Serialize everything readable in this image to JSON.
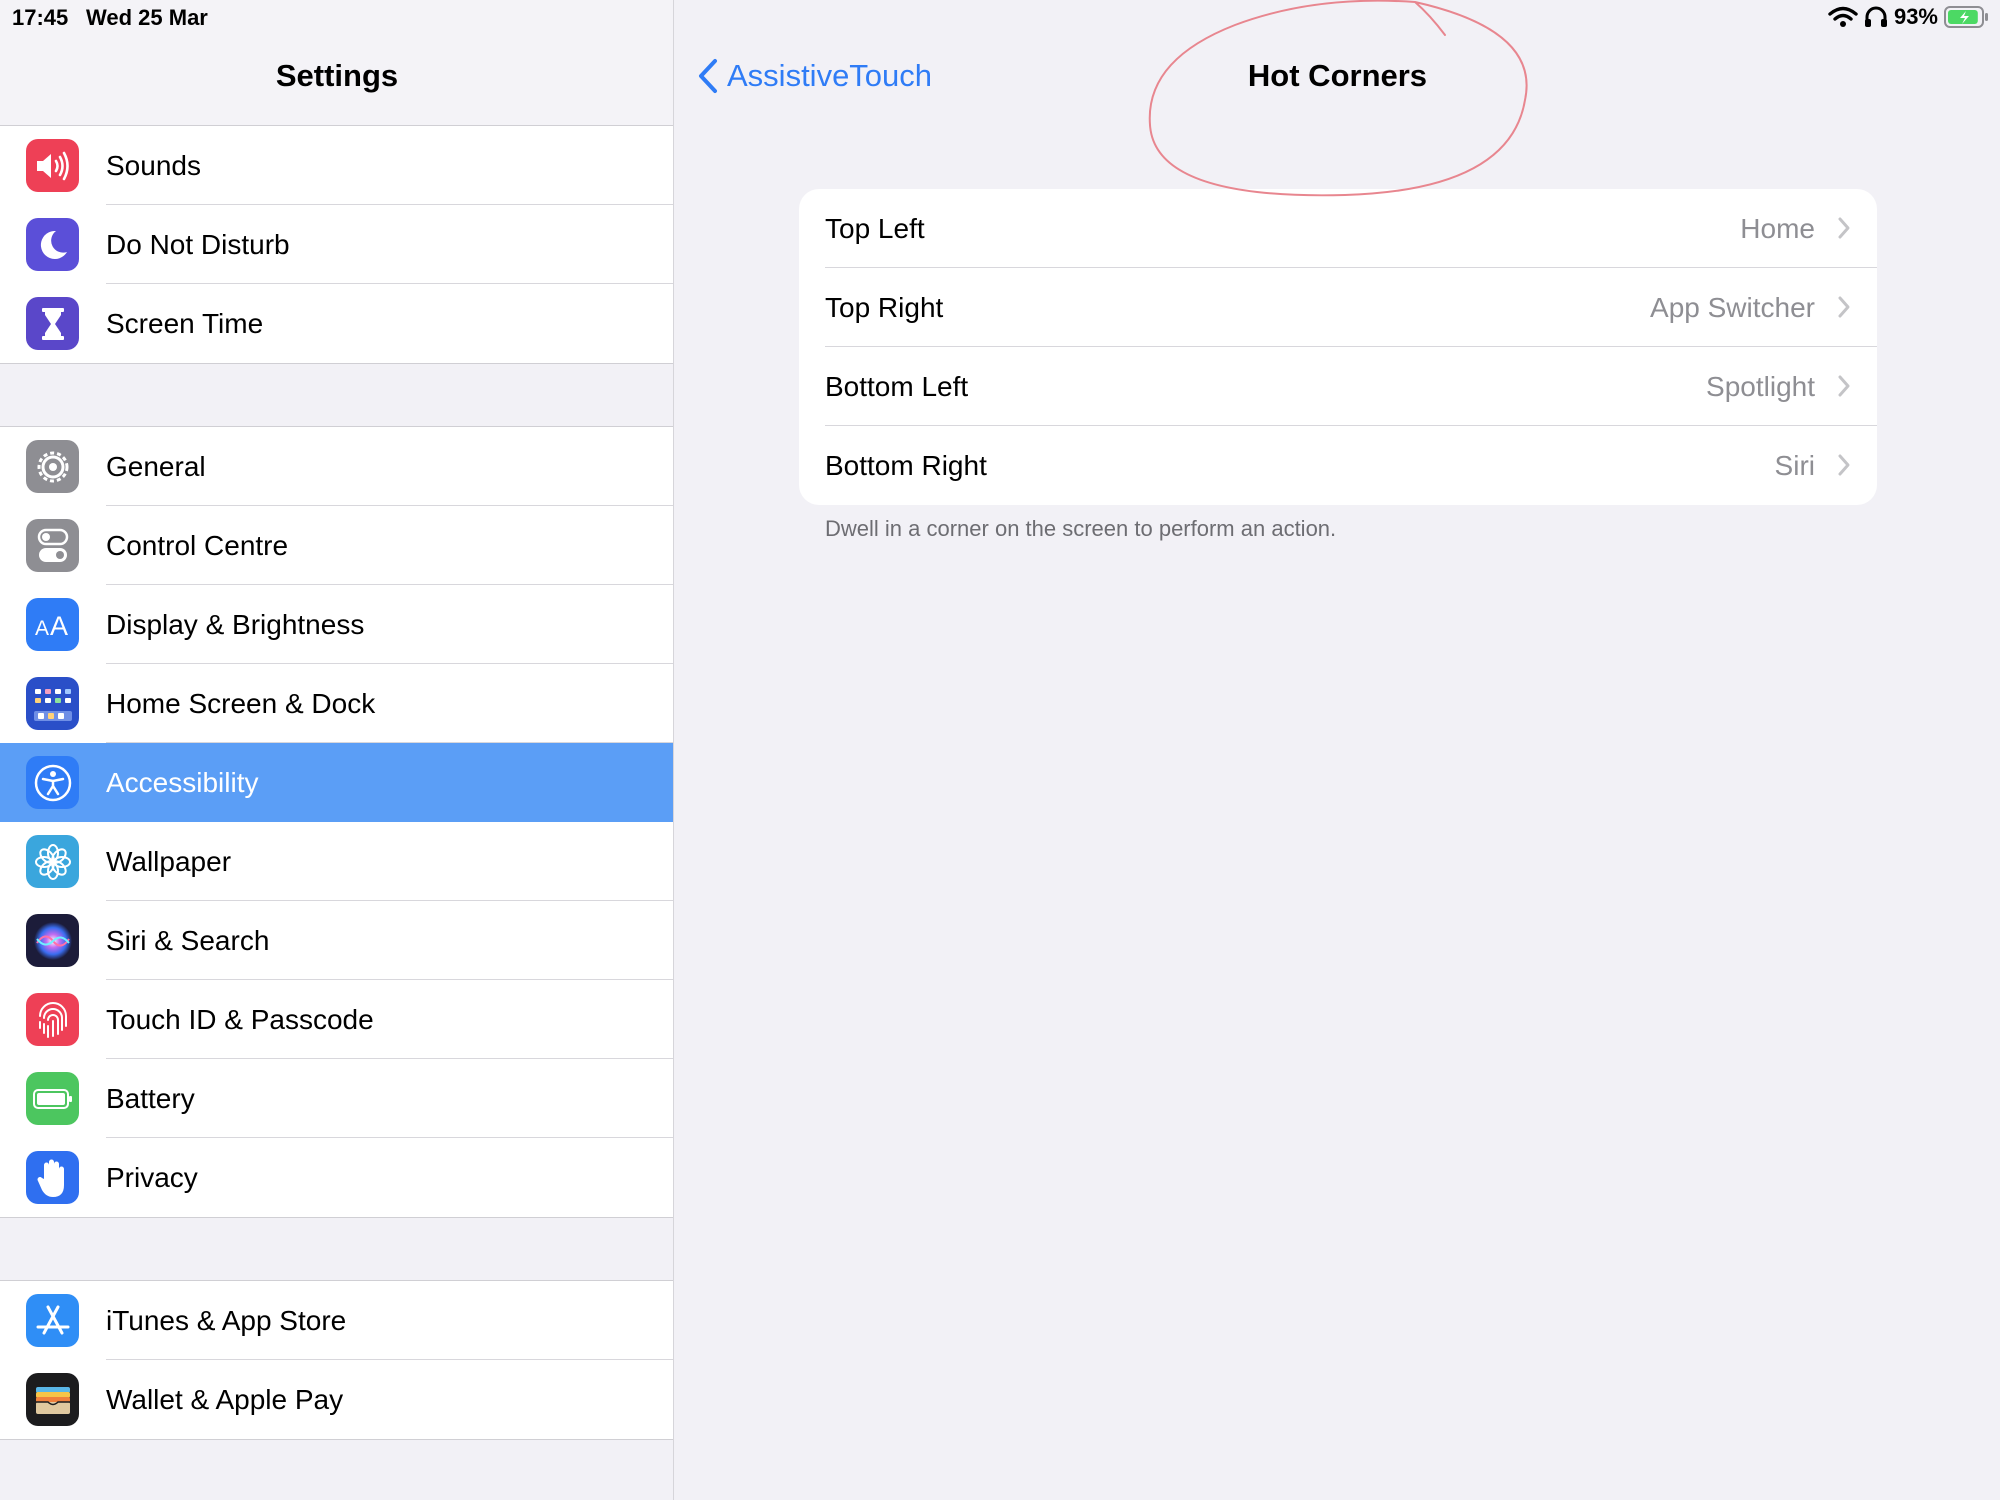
{
  "status_bar": {
    "time": "17:45",
    "date": "Wed 25 Mar",
    "battery_percent": "93%",
    "battery_level": 0.93
  },
  "sidebar": {
    "title": "Settings",
    "groups": [
      {
        "items": [
          {
            "label": "Sounds",
            "icon": "speaker-icon",
            "color": "#ee4056"
          },
          {
            "label": "Do Not Disturb",
            "icon": "moon-icon",
            "color": "#5b4fd8"
          },
          {
            "label": "Screen Time",
            "icon": "hourglass-icon",
            "color": "#5a47c9"
          }
        ]
      },
      {
        "items": [
          {
            "label": "General",
            "icon": "gear-icon",
            "color": "#8e8e93"
          },
          {
            "label": "Control Centre",
            "icon": "toggles-icon",
            "color": "#8e8e93"
          },
          {
            "label": "Display & Brightness",
            "icon": "text-size-icon",
            "color": "#2f7cf6"
          },
          {
            "label": "Home Screen & Dock",
            "icon": "app-grid-icon",
            "color": "#2a4fc8"
          },
          {
            "label": "Accessibility",
            "icon": "accessibility-icon",
            "color": "#2f7cf6",
            "selected": true
          },
          {
            "label": "Wallpaper",
            "icon": "flower-icon",
            "color": "#3aa6dd"
          },
          {
            "label": "Siri & Search",
            "icon": "siri-icon",
            "color": "#1c1c3a"
          },
          {
            "label": "Touch ID & Passcode",
            "icon": "fingerprint-icon",
            "color": "#ee4056"
          },
          {
            "label": "Battery",
            "icon": "battery-icon",
            "color": "#4cc65f"
          },
          {
            "label": "Privacy",
            "icon": "hand-icon",
            "color": "#2f6ff0"
          }
        ]
      },
      {
        "items": [
          {
            "label": "iTunes & App Store",
            "icon": "app-store-icon",
            "color": "#2f8ef6"
          },
          {
            "label": "Wallet & Apple Pay",
            "icon": "wallet-icon",
            "color": "#1c1c1e"
          }
        ]
      }
    ]
  },
  "detail": {
    "back_label": "AssistiveTouch",
    "title": "Hot Corners",
    "rows": [
      {
        "label": "Top Left",
        "value": "Home"
      },
      {
        "label": "Top Right",
        "value": "App Switcher"
      },
      {
        "label": "Bottom Left",
        "value": "Spotlight"
      },
      {
        "label": "Bottom Right",
        "value": "Siri"
      }
    ],
    "footnote": "Dwell in a corner on the screen to perform an action."
  },
  "colors": {
    "accent": "#2f7cf6",
    "selected_row": "#5b9ef6",
    "annotation": "#e8868f"
  }
}
